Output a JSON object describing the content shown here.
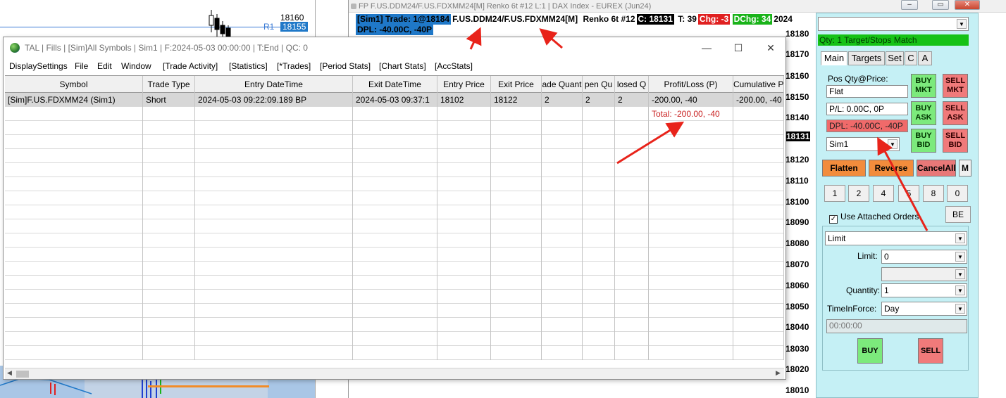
{
  "bg_chart": {
    "price_top": "18160",
    "r1_label": "R1",
    "r1_price": "18155"
  },
  "chart": {
    "title": "FP F.US.DDM24/F.US.FDXMM24[M]  Renko 6t #12 L:1 | DAX Index - EUREX (Jun24)",
    "info": {
      "trade": "[Sim1]  Trade: 1@18184",
      "symbol": "F.US.DDM24/F.US.FDXMM24[M]",
      "bar": "Renko 6t #12",
      "close": "C: 18131",
      "ticks": "T: 39",
      "chg": "Chg: -3",
      "dchg": "DChg: 34",
      "trunc": "2024",
      "dpl": "DPL: -40.00C, -40P"
    },
    "price_axis": [
      "18180",
      "18170",
      "18160",
      "18150",
      "18140",
      "18131",
      "18120",
      "18110",
      "18100",
      "18090",
      "18080",
      "18070",
      "18060",
      "18050",
      "18040",
      "18030",
      "18020",
      "18010"
    ],
    "current_price": "18131",
    "colors": {
      "up": "#19b319",
      "down": "#e02020",
      "accent": "#1f78c8"
    }
  },
  "order_panel": {
    "account_dropdown": "",
    "qty_match": "Qty: 1 Target/Stops Match",
    "tabs": [
      "Main",
      "Targets",
      "Set",
      "C",
      "A"
    ],
    "pos_label": "Pos Qty@Price:",
    "pos_value": "Flat",
    "pl_value": "P/L: 0.00C, 0P",
    "dpl_value": "DPL: -40.00C, -40P",
    "account": "Sim1",
    "buy_mkt": "BUY MKT",
    "sell_mkt": "SELL MKT",
    "buy_ask": "BUY ASK",
    "sell_ask": "SELL ASK",
    "buy_bid": "BUY BID",
    "sell_bid": "SELL BID",
    "flatten": "Flatten",
    "reverse": "Reverse",
    "cancel_all": "CancelAll",
    "m": "M",
    "qty_buttons": [
      "1",
      "2",
      "4",
      "5",
      "8",
      "0"
    ],
    "use_attached": "Use Attached Orders",
    "be": "BE",
    "order_type": "Limit",
    "limit_label": "Limit:",
    "limit_value": "0",
    "quantity_label": "Quantity:",
    "quantity_value": "1",
    "tif_label": "TimeInForce:",
    "tif_value": "Day",
    "time_value": "00:00:00",
    "buy": "BUY",
    "sell": "SELL"
  },
  "tal": {
    "title": "TAL | Fills | [Sim]All Symbols | Sim1 | F:2024-05-03  00:00:00 | T:End | QC: 0",
    "menu": [
      "DisplaySettings",
      "File",
      "Edit",
      "Window",
      "[Trade Activity]",
      "[Statistics]",
      "[*Trades]",
      "[Period Stats]",
      "[Chart Stats]",
      "[AccStats]"
    ],
    "columns": [
      "Symbol",
      "Trade Type",
      "Entry DateTime",
      "Exit DateTime",
      "Entry Price",
      "Exit Price",
      "ade Quant",
      "pen Qu",
      "losed Q",
      "Profit/Loss (P)",
      "Cumulative P"
    ],
    "rows": [
      [
        "[Sim]F.US.FDXMM24 (Sim1)",
        "Short",
        "2024-05-03  09:22:09.189 BP",
        "2024-05-03  09:37:1",
        "18102",
        "18122",
        "2",
        "2",
        "2",
        "-200.00, -40",
        "-200.00, -40"
      ]
    ],
    "total": "Total: -200.00, -40"
  }
}
